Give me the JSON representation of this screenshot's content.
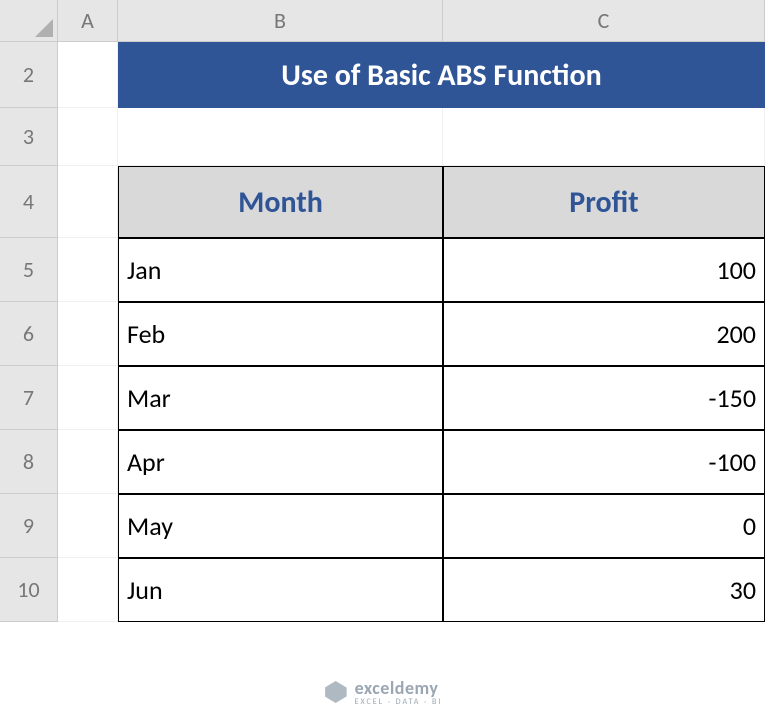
{
  "columns": [
    "A",
    "B",
    "C"
  ],
  "rows": [
    "2",
    "3",
    "4",
    "5",
    "6",
    "7",
    "8",
    "9",
    "10"
  ],
  "title": "Use of Basic ABS Function",
  "headers": {
    "month": "Month",
    "profit": "Profit"
  },
  "data": [
    {
      "month": "Jan",
      "profit": "100"
    },
    {
      "month": "Feb",
      "profit": "200"
    },
    {
      "month": "Mar",
      "profit": "-150"
    },
    {
      "month": "Apr",
      "profit": "-100"
    },
    {
      "month": "May",
      "profit": "0"
    },
    {
      "month": "Jun",
      "profit": "30"
    }
  ],
  "watermark": {
    "brand": "exceldemy",
    "tag": "EXCEL · DATA · BI"
  }
}
